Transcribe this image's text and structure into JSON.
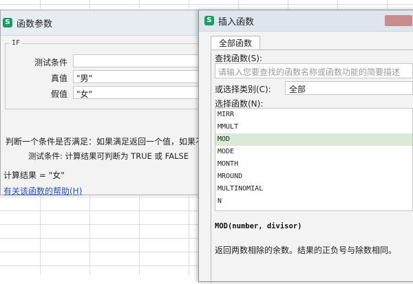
{
  "args_dialog": {
    "title": "函数参数",
    "app_icon": "S",
    "function_name": "IF",
    "fields": [
      {
        "label": "测试条件",
        "value": ""
      },
      {
        "label": "真值",
        "value": "\"男\""
      },
      {
        "label": "假值",
        "value": "\"女\""
      }
    ],
    "description": "判断一个条件是否满足：如果满足返回一个值，如果不",
    "param_help": "测试条件:  计算结果可判断为 TRUE 或 FALSE",
    "result": "计算结果 = \"女\"",
    "help_link": "有关该函数的帮助(H)"
  },
  "insert_dialog": {
    "title": "插入函数",
    "app_icon": "S",
    "tab": "全部函数",
    "search_label": "查找函数(S):",
    "search_placeholder": "请输入您要查找的函数名称或函数功能的简要描述",
    "category_label": "或选择类别(C):",
    "category_value": "全部",
    "select_label": "选择函数(N):",
    "functions": [
      "MIRR",
      "MMULT",
      "MOD",
      "MODE",
      "MONTH",
      "MROUND",
      "MULTINOMIAL",
      "N"
    ],
    "selected_function": "MOD",
    "syntax": "MOD(number, divisor)",
    "description": "返回两数相除的余数。结果的正负号与除数相同。"
  },
  "colors": {
    "icon_green": "#17a05d",
    "selected_row": "#dbe9d6",
    "link": "#2a4fb5"
  }
}
